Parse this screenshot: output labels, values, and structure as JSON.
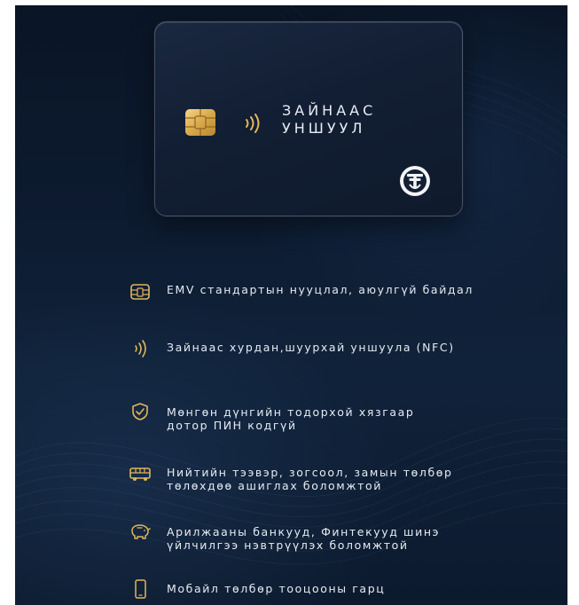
{
  "card": {
    "title_line1": "ЗАЙНААС",
    "title_line2": "УНШУУЛ",
    "chip_icon": "emv-chip-icon",
    "nfc_icon": "contactless-icon",
    "logo_icon": "bank-logo-icon"
  },
  "features": [
    {
      "icon": "emv-chip-icon",
      "lines": [
        "EMV стандартын нууцлал, аюулгүй байдал"
      ]
    },
    {
      "icon": "contactless-icon",
      "lines": [
        "Зайнаас хурдан,шуурхай уншуула (NFC)"
      ]
    },
    {
      "icon": "shield-check-icon",
      "lines": [
        "Мөнгөн дүнгийн тодорхой хязгаар",
        "дотор ПИН кодгүй"
      ]
    },
    {
      "icon": "bus-icon",
      "lines": [
        "Нийтийн тээвэр, зогсоол, замын төлбөр",
        "төлөхдөө ашиглах боломжтой"
      ]
    },
    {
      "icon": "piggy-bank-icon",
      "lines": [
        "Арилжааны банкууд, Финтекууд шинэ",
        "үйлчилгээ нэвтрүүлэх боломжтой"
      ]
    },
    {
      "icon": "mobile-phone-icon",
      "lines": [
        "Мобайл төлбөр тооцооны гарц"
      ]
    }
  ],
  "colors": {
    "background": "#0d1b30",
    "chip_gold": "#e0b65a",
    "text": "#e6ebf2"
  }
}
